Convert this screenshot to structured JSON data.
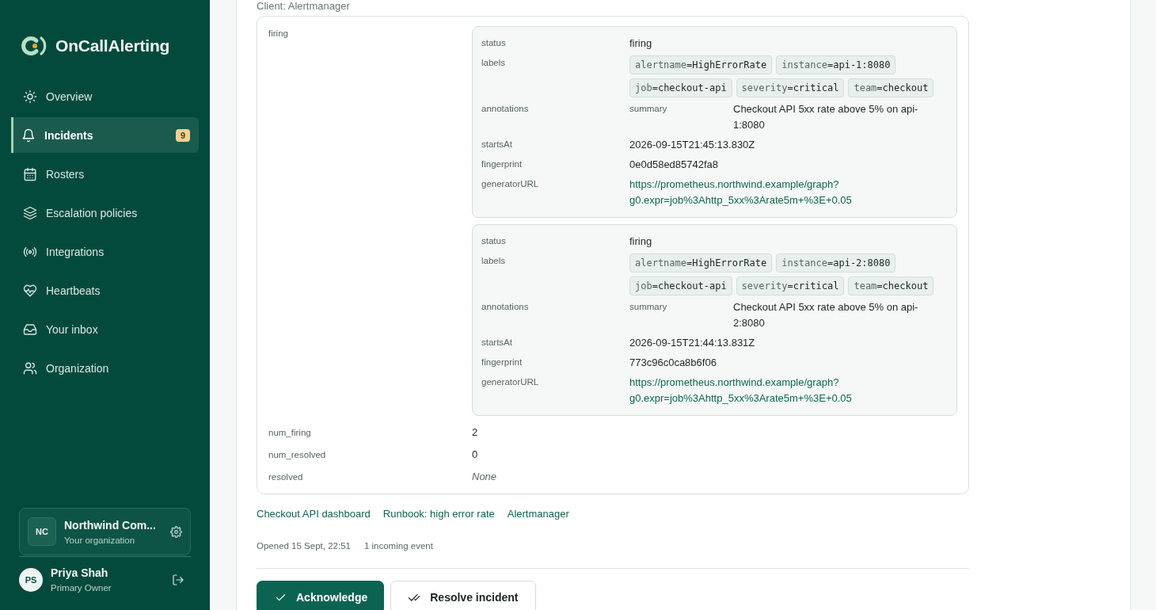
{
  "sidebar": {
    "brand": "OnCallAlerting",
    "nav": [
      {
        "label": "Overview",
        "selected": false
      },
      {
        "label": "Incidents",
        "selected": true,
        "badge": "9"
      },
      {
        "label": "Rosters",
        "selected": false
      },
      {
        "label": "Escalation policies",
        "selected": false
      },
      {
        "label": "Integrations",
        "selected": false
      },
      {
        "label": "Heartbeats",
        "selected": false
      },
      {
        "label": "Your inbox",
        "selected": false
      },
      {
        "label": "Organization",
        "selected": false
      }
    ],
    "organization": {
      "initials": "NC",
      "name": "Northwind Com...",
      "subtitle": "Your organization"
    },
    "user": {
      "initials": "PS",
      "name": "Priya Shah",
      "role": "Primary Owner"
    }
  },
  "main": {
    "heading": "Client: Alertmanager",
    "payload": {
      "firing_key": "firing",
      "alerts": [
        {
          "fields": [
            {
              "key": "status",
              "kind": "text",
              "value": "firing"
            },
            {
              "key": "labels",
              "kind": "labels",
              "labels": [
                {
                  "key": "alertname",
                  "separator": "=",
                  "value": "HighErrorRate"
                },
                {
                  "key": "instance",
                  "separator": "=",
                  "value": "api-1:8080"
                },
                {
                  "key": "job",
                  "separator": "=",
                  "value": "checkout-api"
                },
                {
                  "key": "severity",
                  "separator": "=",
                  "value": "critical"
                },
                {
                  "key": "team",
                  "separator": "=",
                  "value": "checkout"
                }
              ]
            },
            {
              "key": "annotations",
              "kind": "map",
              "entries": [
                {
                  "key": "summary",
                  "value": "Checkout API 5xx rate above 5% on api-1:8080"
                }
              ]
            },
            {
              "key": "startsAt",
              "kind": "text",
              "value": "2026-09-15T21:45:13.830Z"
            },
            {
              "key": "fingerprint",
              "kind": "text",
              "value": "0e0d58ed85742fa8"
            },
            {
              "key": "generatorURL",
              "kind": "link",
              "value": "https://prometheus.northwind.example/graph?g0.expr=job%3Ahttp_5xx%3Arate5m+%3E+0.05"
            }
          ]
        },
        {
          "fields": [
            {
              "key": "status",
              "kind": "text",
              "value": "firing"
            },
            {
              "key": "labels",
              "kind": "labels",
              "labels": [
                {
                  "key": "alertname",
                  "separator": "=",
                  "value": "HighErrorRate"
                },
                {
                  "key": "instance",
                  "separator": "=",
                  "value": "api-2:8080"
                },
                {
                  "key": "job",
                  "separator": "=",
                  "value": "checkout-api"
                },
                {
                  "key": "severity",
                  "separator": "=",
                  "value": "critical"
                },
                {
                  "key": "team",
                  "separator": "=",
                  "value": "checkout"
                }
              ]
            },
            {
              "key": "annotations",
              "kind": "map",
              "entries": [
                {
                  "key": "summary",
                  "value": "Checkout API 5xx rate above 5% on api-2:8080"
                }
              ]
            },
            {
              "key": "startsAt",
              "kind": "text",
              "value": "2026-09-15T21:44:13.831Z"
            },
            {
              "key": "fingerprint",
              "kind": "text",
              "value": "773c96c0ca8b6f06"
            },
            {
              "key": "generatorURL",
              "kind": "link",
              "value": "https://prometheus.northwind.example/graph?g0.expr=job%3Ahttp_5xx%3Arate5m+%3E+0.05"
            }
          ]
        }
      ],
      "rows": [
        {
          "key": "num_firing",
          "kind": "text",
          "value": "2"
        },
        {
          "key": "num_resolved",
          "kind": "text",
          "value": "0"
        },
        {
          "key": "resolved",
          "kind": "none",
          "value": "None"
        }
      ]
    },
    "links": [
      "Checkout API dashboard",
      "Runbook: high error rate",
      "Alertmanager"
    ],
    "meta": [
      "Opened 15 Sept, 22:51",
      "1 incoming event"
    ],
    "buttons": [
      {
        "label": "Acknowledge",
        "kind": "primary"
      },
      {
        "label": "Resolve incident",
        "kind": "secondary"
      }
    ]
  }
}
